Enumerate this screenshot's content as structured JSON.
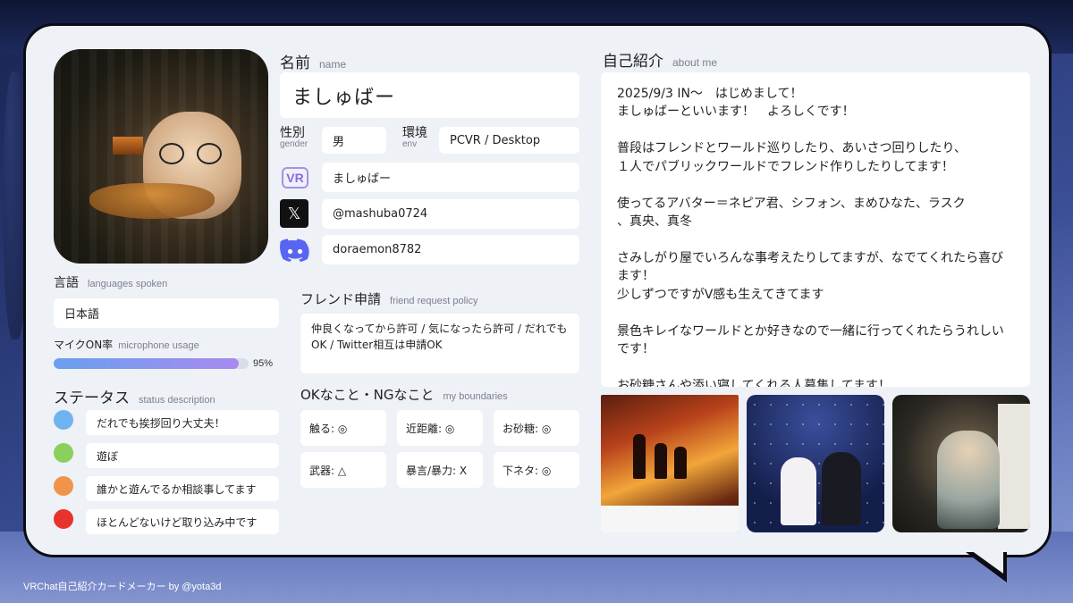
{
  "name_section": {
    "title": "名前",
    "subtitle": "name",
    "value": "ましゅばー"
  },
  "gender": {
    "title": "性別",
    "subtitle": "gender",
    "value": "男"
  },
  "env": {
    "title": "環境",
    "subtitle": "env",
    "value": "PCVR / Desktop"
  },
  "accounts": {
    "vrchat": {
      "icon": "vrchat-icon",
      "icon_text": "VR",
      "value": "ましゅばー"
    },
    "x": {
      "icon": "x-icon",
      "icon_text": "𝕏",
      "value": "@mashuba0724"
    },
    "discord": {
      "icon": "discord-icon",
      "value": "doraemon8782"
    }
  },
  "languages": {
    "title": "言語",
    "subtitle": "languages spoken",
    "value": "日本語"
  },
  "mic": {
    "title": "マイクON率",
    "subtitle": "microphone usage",
    "percent": 95,
    "label": "95%"
  },
  "status": {
    "title": "ステータス",
    "subtitle": "status description",
    "items": [
      {
        "color": "#6fb3ee",
        "label": "だれでも挨拶回り大丈夫！"
      },
      {
        "color": "#8ad05c",
        "label": "遊ぼ"
      },
      {
        "color": "#f0944a",
        "label": "誰かと遊んでるか相談事してます"
      },
      {
        "color": "#e8322c",
        "label": "ほとんどないけど取り込み中です"
      }
    ]
  },
  "friend_request": {
    "title": "フレンド申請",
    "subtitle": "friend request policy",
    "text": "仲良くなってから許可 / 気になったら許可 / だれでもOK / Twitter相互は申請OK"
  },
  "boundaries": {
    "title": "OKなこと・NGなこと",
    "subtitle": "my boundaries",
    "items": [
      "触る: ◎",
      "近距離: ◎",
      "お砂糖: ◎",
      "武器: △",
      "暴言/暴力: X",
      "下ネタ: ◎"
    ]
  },
  "about": {
    "title": "自己紹介",
    "subtitle": "about me",
    "text": "2025/9/3 IN〜　はじめまして！\nましゅばーといいます！　よろしくです！\n\n普段はフレンドとワールド巡りしたり、あいさつ回りしたり、\n１人でパブリックワールドでフレンド作りしたりしてます！\n\n使ってるアバター＝ネピア君、シフォン、まめひなた、ラスク\n、真央、真冬\n\nさみしがり屋でいろんな事考えたりしてますが、なでてくれたら喜びます！\n少しずつですがV感も生えてきてます\n\n景色キレイなワールドとか好きなので一緒に行ってくれたらうれしいです！\n\nお砂糖さんや添い寝してくれる人募集してます！"
  },
  "credit": "VRChat自己紹介カードメーカー by @yota3d"
}
